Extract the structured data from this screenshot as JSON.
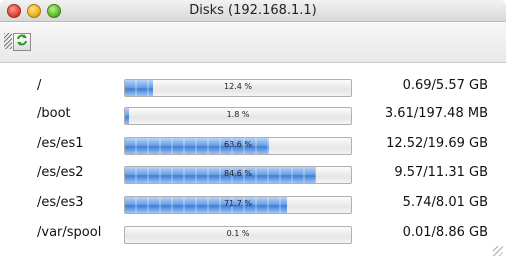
{
  "window": {
    "title": "Disks (192.168.1.1)"
  },
  "toolbar": {
    "refresh_icon": "refresh-arrows-icon"
  },
  "disks": [
    {
      "mount": "/",
      "percent_label": "12.4 %",
      "percent": 12.4,
      "size": "0.69/5.57 GB"
    },
    {
      "mount": "/boot",
      "percent_label": "1.8 %",
      "percent": 1.8,
      "size": "3.61/197.48 MB"
    },
    {
      "mount": "/es/es1",
      "percent_label": "63.6 %",
      "percent": 63.6,
      "size": "12.52/19.69 GB"
    },
    {
      "mount": "/es/es2",
      "percent_label": "84.6 %",
      "percent": 84.6,
      "size": "9.57/11.31 GB"
    },
    {
      "mount": "/es/es3",
      "percent_label": "71.7 %",
      "percent": 71.7,
      "size": "5.74/8.01 GB"
    },
    {
      "mount": "/var/spool",
      "percent_label": "0.1 %",
      "percent": 0.1,
      "size": "0.01/8.86 GB"
    }
  ],
  "colors": {
    "bar_fill": "#5b92e3",
    "close_button": "#e0443a",
    "minimize_button": "#f0b21a",
    "zoom_button": "#5cbf2a"
  }
}
